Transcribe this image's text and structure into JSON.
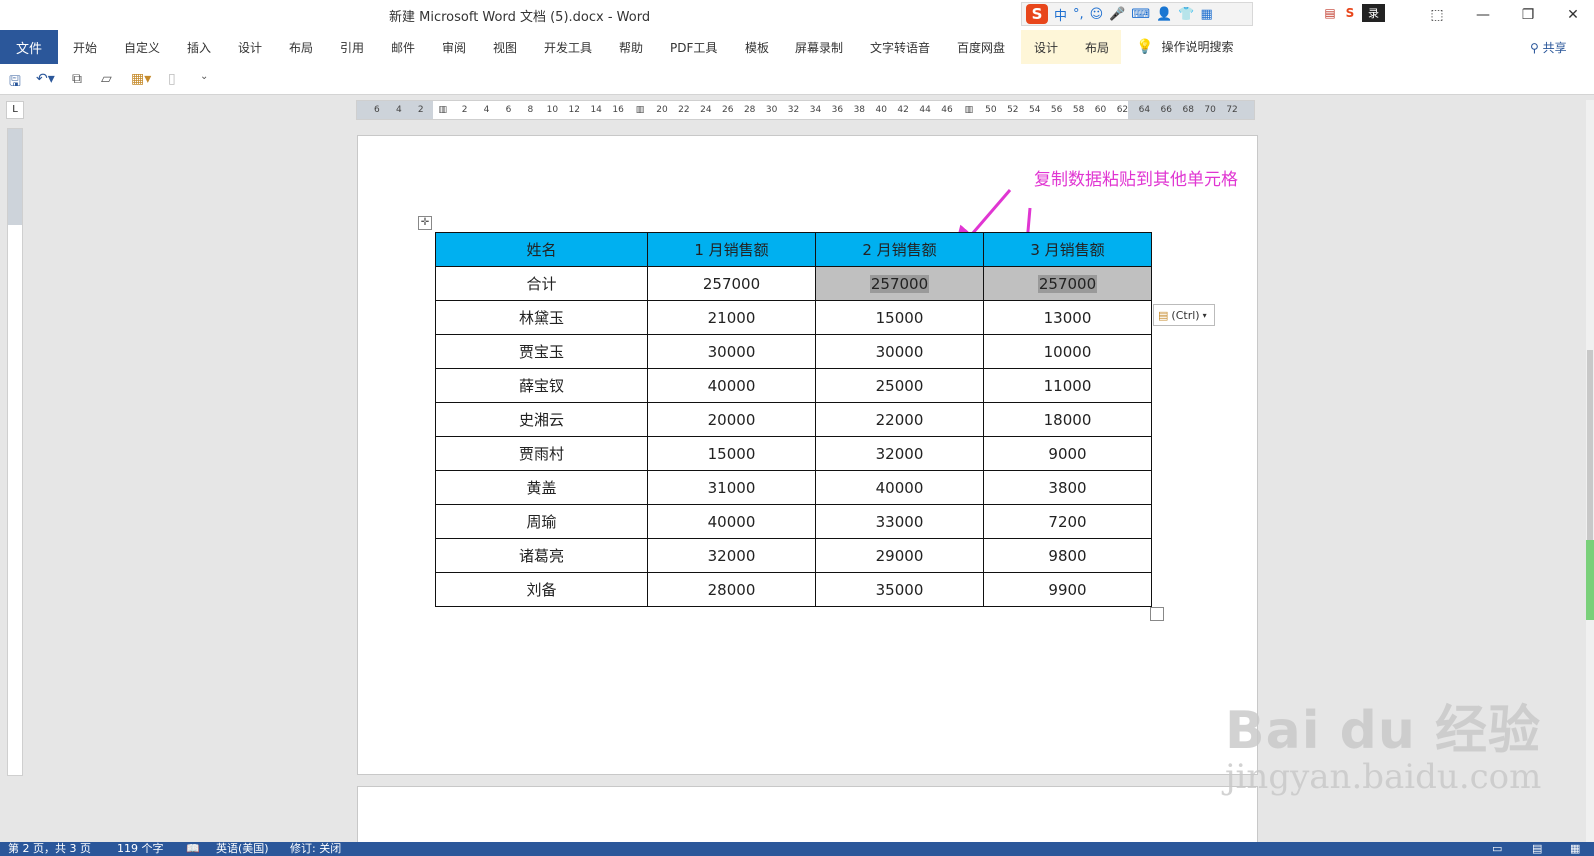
{
  "window": {
    "title": "新建 Microsoft Word 文档 (5).docx  -  Word",
    "controls": [
      "⬚",
      "—",
      "❐",
      "✕"
    ]
  },
  "ime": {
    "logo": "S",
    "items": [
      "中",
      "°,",
      "☺",
      "🎤",
      "⌨",
      "👤",
      "👕",
      "▦"
    ],
    "tray_label": "录"
  },
  "ribbon": {
    "file_tab": "文件",
    "tabs": [
      "开始",
      "自定义",
      "插入",
      "设计",
      "布局",
      "引用",
      "邮件",
      "审阅",
      "视图",
      "开发工具",
      "帮助",
      "PDF工具",
      "模板",
      "屏幕录制",
      "文字转语音",
      "百度网盘"
    ],
    "context_tabs": [
      "设计",
      "布局"
    ],
    "search_icon": "lightbulb-icon",
    "search_label": "操作说明搜索",
    "share_label": "共享"
  },
  "ruler": {
    "ticks": [
      "6",
      "4",
      "2",
      "",
      "2",
      "4",
      "6",
      "8",
      "10",
      "12",
      "14",
      "16",
      "",
      "20",
      "22",
      "24",
      "26",
      "28",
      "30",
      "32",
      "34",
      "36",
      "38",
      "40",
      "42",
      "44",
      "46",
      "",
      "50",
      "52",
      "54",
      "56",
      "58",
      "60",
      "62",
      "64",
      "66",
      "68",
      "70",
      "72"
    ],
    "corner": "L"
  },
  "annotation": {
    "text": "复制数据粘贴到其他单元格",
    "color": "#e036d2"
  },
  "table": {
    "headers": [
      "姓名",
      "1 月销售额",
      "2 月销售额",
      "3 月销售额"
    ],
    "header_color": "#00b0f0",
    "rows": [
      [
        "合计",
        "257000",
        "257000",
        "257000"
      ],
      [
        "林黛玉",
        "21000",
        "15000",
        "13000"
      ],
      [
        "贾宝玉",
        "30000",
        "30000",
        "10000"
      ],
      [
        "薛宝钗",
        "40000",
        "25000",
        "11000"
      ],
      [
        "史湘云",
        "20000",
        "22000",
        "18000"
      ],
      [
        "贾雨村",
        "15000",
        "32000",
        "9000"
      ],
      [
        "黄盖",
        "31000",
        "40000",
        "3800"
      ],
      [
        "周瑜",
        "40000",
        "33000",
        "7200"
      ],
      [
        "诸葛亮",
        "32000",
        "29000",
        "9800"
      ],
      [
        "刘备",
        "28000",
        "35000",
        "9900"
      ]
    ]
  },
  "paste_options": {
    "label": "(Ctrl)"
  },
  "watermark": {
    "logo": "Bai du 经验",
    "url": "jingyan.baidu.com"
  },
  "status": {
    "page": "第 2 页，共 3 页",
    "words": "119 个字",
    "language": "英语(美国)",
    "track": "修订: 关闭"
  }
}
